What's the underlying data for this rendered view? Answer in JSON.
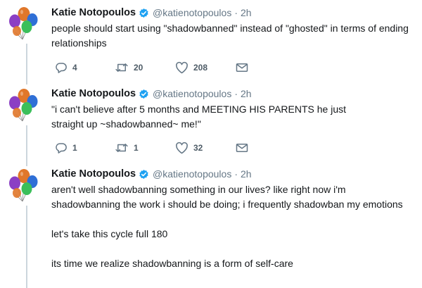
{
  "tweets": [
    {
      "author": "Katie Notopoulos",
      "handle": "@katienotopoulos",
      "separator": "·",
      "time": "2h",
      "paragraphs": [
        "people should start using \"shadowbanned\" instead of \"ghosted\" in terms of ending relationships"
      ],
      "replies": "4",
      "retweets": "20",
      "likes": "208"
    },
    {
      "author": "Katie Notopoulos",
      "handle": "@katienotopoulos",
      "separator": "·",
      "time": "2h",
      "paragraphs": [
        "\"i can't believe after 5 months and MEETING HIS PARENTS he just straight up ~shadowbanned~ me!\""
      ],
      "replies": "1",
      "retweets": "1",
      "likes": "32"
    },
    {
      "author": "Katie Notopoulos",
      "handle": "@katienotopoulos",
      "separator": "·",
      "time": "2h",
      "paragraphs": [
        "aren't well shadowbanning something in our lives? like right now i'm shadowbanning the work i should be doing; i frequently shadowban my emotions",
        "let's take this cycle full 180",
        "its time we realize shadowbanning is a form of self-care"
      ]
    }
  ],
  "icons": {
    "avatar": "balloons-avatar-icon",
    "verified": "verified-badge-icon",
    "reply": "reply-icon",
    "retweet": "retweet-icon",
    "like": "heart-icon",
    "message": "envelope-icon"
  },
  "colors": {
    "verified": "#1da1f2",
    "action_icon": "#657786",
    "thread_line": "#ccd6dd",
    "balloon_orange": "#e0772a",
    "balloon_blue": "#2f6fd6",
    "balloon_purple": "#8b3fc4",
    "balloon_green": "#3bbf5a"
  }
}
